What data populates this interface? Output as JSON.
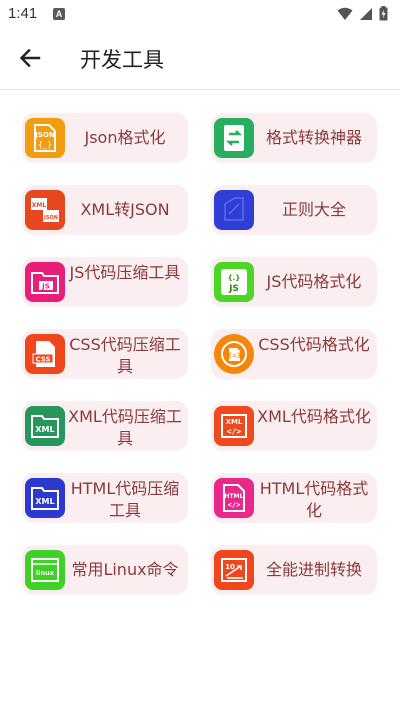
{
  "status_bar": {
    "time": "1:41",
    "notification_letter": "A"
  },
  "app_bar": {
    "title": "开发工具"
  },
  "tools": [
    {
      "label": "Json格式化",
      "icon": "json-file-icon",
      "color": "#f39c12"
    },
    {
      "label": "格式转换神器",
      "icon": "convert-icon",
      "color": "#27ae60"
    },
    {
      "label": "XML转JSON",
      "icon": "xml-to-json-icon",
      "color": "#e8461f"
    },
    {
      "label": "正则大全",
      "icon": "regex-icon",
      "color": "#2f3fd6"
    },
    {
      "label": "JS代码压缩工具",
      "icon": "js-folder-icon",
      "color": "#e91e7a"
    },
    {
      "label": "JS代码格式化",
      "icon": "js-format-icon",
      "color": "#4cd626"
    },
    {
      "label": "CSS代码压缩工具",
      "icon": "css-file-icon",
      "color": "#f0461c"
    },
    {
      "label": "CSS代码格式化",
      "icon": "css-format-icon",
      "color": "#f5860a"
    },
    {
      "label": "XML代码压缩工具",
      "icon": "xml-folder-icon",
      "color": "#27965a"
    },
    {
      "label": "XML代码格式化",
      "icon": "xml-format-icon",
      "color": "#ee4a1e"
    },
    {
      "label": "HTML代码压缩工具",
      "icon": "html-folder-icon",
      "color": "#2b39d0"
    },
    {
      "label": "HTML代码格式化",
      "icon": "html-file-icon",
      "color": "#e8288a"
    },
    {
      "label": "常用Linux命令",
      "icon": "linux-icon",
      "color": "#3ed126"
    },
    {
      "label": "全能进制转换",
      "icon": "number-convert-icon",
      "color": "#f0461c"
    }
  ]
}
